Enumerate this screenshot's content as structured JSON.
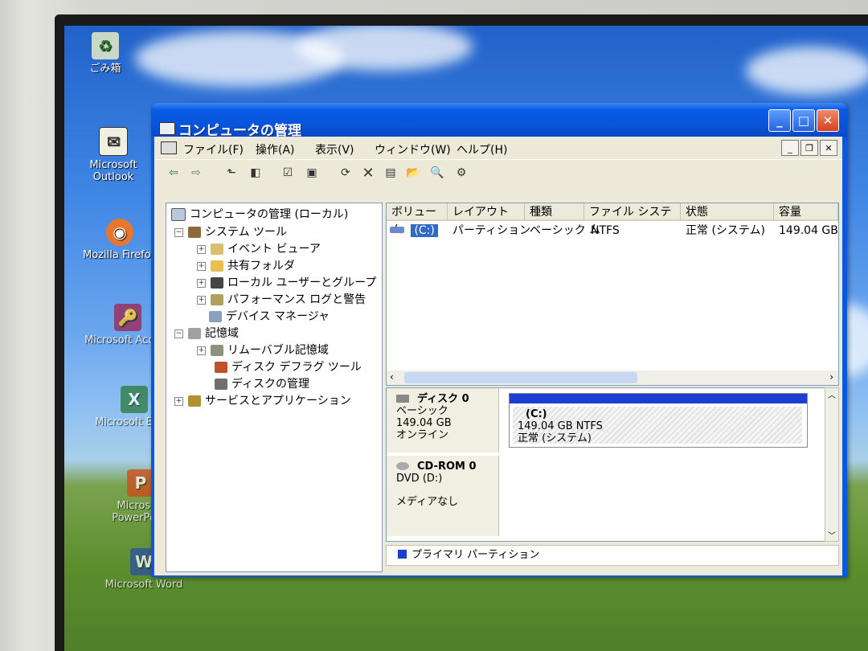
{
  "desktop": {
    "icons": [
      {
        "label": "ごみ箱",
        "icon": "recycle-bin-icon"
      },
      {
        "label": "Microsoft Outlook",
        "icon": "outlook-icon"
      },
      {
        "label": "Mozilla Firefox",
        "icon": "firefox-icon"
      },
      {
        "label": "Microsoft Access",
        "icon": "access-icon"
      },
      {
        "label": "Microsoft Excel",
        "icon": "excel-icon"
      },
      {
        "label": "Microsoft PowerPoint",
        "icon": "powerpoint-icon"
      },
      {
        "label": "Microsoft Word",
        "icon": "word-icon"
      }
    ]
  },
  "window": {
    "title": "コンピュータの管理",
    "controls": {
      "minimize": "_",
      "maximize": "□",
      "close": "✕"
    }
  },
  "menubar": {
    "items": [
      "ファイル(F)",
      "操作(A)",
      "表示(V)",
      "ウィンドウ(W)",
      "ヘルプ(H)"
    ]
  },
  "tree": {
    "root": "コンピュータの管理 (ローカル)",
    "items": [
      {
        "label": "システム ツール",
        "level": 1,
        "expander": "−"
      },
      {
        "label": "イベント ビューア",
        "level": 2,
        "expander": "+"
      },
      {
        "label": "共有フォルダ",
        "level": 2,
        "expander": "+"
      },
      {
        "label": "ローカル ユーザーとグループ",
        "level": 2,
        "expander": "+"
      },
      {
        "label": "パフォーマンス ログと警告",
        "level": 2,
        "expander": "+"
      },
      {
        "label": "デバイス マネージャ",
        "level": 2,
        "expander": ""
      },
      {
        "label": "記憶域",
        "level": 1,
        "expander": "−"
      },
      {
        "label": "リムーバブル記憶域",
        "level": 2,
        "expander": "+"
      },
      {
        "label": "ディスク デフラグ ツール",
        "level": 2,
        "expander": ""
      },
      {
        "label": "ディスクの管理",
        "level": 2,
        "expander": ""
      },
      {
        "label": "サービスとアプリケーション",
        "level": 1,
        "expander": "+"
      }
    ]
  },
  "volume_list": {
    "columns": [
      "ボリューム",
      "レイアウト",
      "種類",
      "ファイル システム",
      "状態",
      "容量"
    ],
    "rows": [
      {
        "volume": "(C:)",
        "layout": "パーティション",
        "type": "ベーシック",
        "fs": "NTFS",
        "status": "正常 (システム)",
        "capacity": "149.04 GB"
      }
    ]
  },
  "disks": [
    {
      "name": "ディスク 0",
      "type": "ベーシック",
      "size": "149.04 GB",
      "state": "オンライン",
      "partition": {
        "label": "(C:)",
        "detail": "149.04 GB NTFS",
        "status": "正常 (システム)"
      }
    },
    {
      "name": "CD-ROM 0",
      "type": "DVD (D:)",
      "size": "",
      "state": "メディアなし"
    }
  ],
  "legend": {
    "primary": "プライマリ パーティション"
  },
  "colors": {
    "titlebar": "#0753d9",
    "partition_bar": "#1d3fcf",
    "window_bg": "#ece9d8"
  }
}
